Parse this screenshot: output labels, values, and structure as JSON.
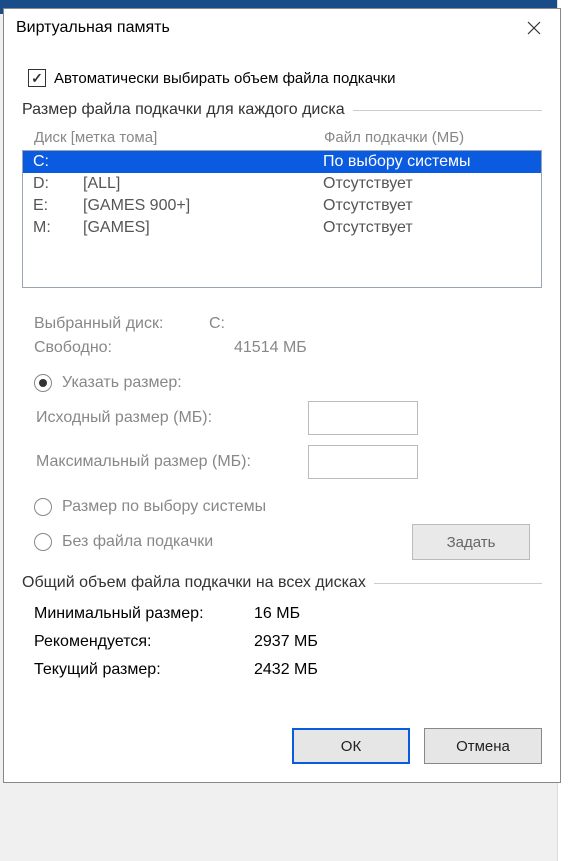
{
  "title": "Виртуальная память",
  "auto_checkbox": {
    "label": "Автоматически выбирать объем файла подкачки",
    "checked": true
  },
  "group1_header": "Размер файла подкачки для каждого диска",
  "columns": {
    "drive": "Диск [метка тома]",
    "pf": "Файл подкачки (МБ)"
  },
  "drives": [
    {
      "letter": "C:",
      "label": "",
      "pf": "По выбору системы",
      "selected": true
    },
    {
      "letter": "D:",
      "label": "[ALL]",
      "pf": "Отсутствует",
      "selected": false
    },
    {
      "letter": "E:",
      "label": "[GAMES 900+]",
      "pf": "Отсутствует",
      "selected": false
    },
    {
      "letter": "M:",
      "label": "[GAMES]",
      "pf": "Отсутствует",
      "selected": false
    }
  ],
  "selected_drive": {
    "key": "Выбранный диск:",
    "val": "C:"
  },
  "free_space": {
    "key": "Свободно:",
    "val": "41514 МБ"
  },
  "radio_custom": "Указать размер:",
  "initial_size": {
    "label": "Исходный размер (МБ):",
    "value": ""
  },
  "max_size": {
    "label": "Максимальный размер (МБ):",
    "value": ""
  },
  "radio_system": "Размер по выбору системы",
  "radio_none": "Без файла подкачки",
  "btn_set": "Задать",
  "group2_header": "Общий объем файла подкачки на всех дисках",
  "totals": {
    "min": {
      "key": "Минимальный размер:",
      "val": "16 МБ"
    },
    "rec": {
      "key": "Рекомендуется:",
      "val": "2937 МБ"
    },
    "cur": {
      "key": "Текущий размер:",
      "val": "2432 МБ"
    }
  },
  "btn_ok": "ОК",
  "btn_cancel": "Отмена"
}
